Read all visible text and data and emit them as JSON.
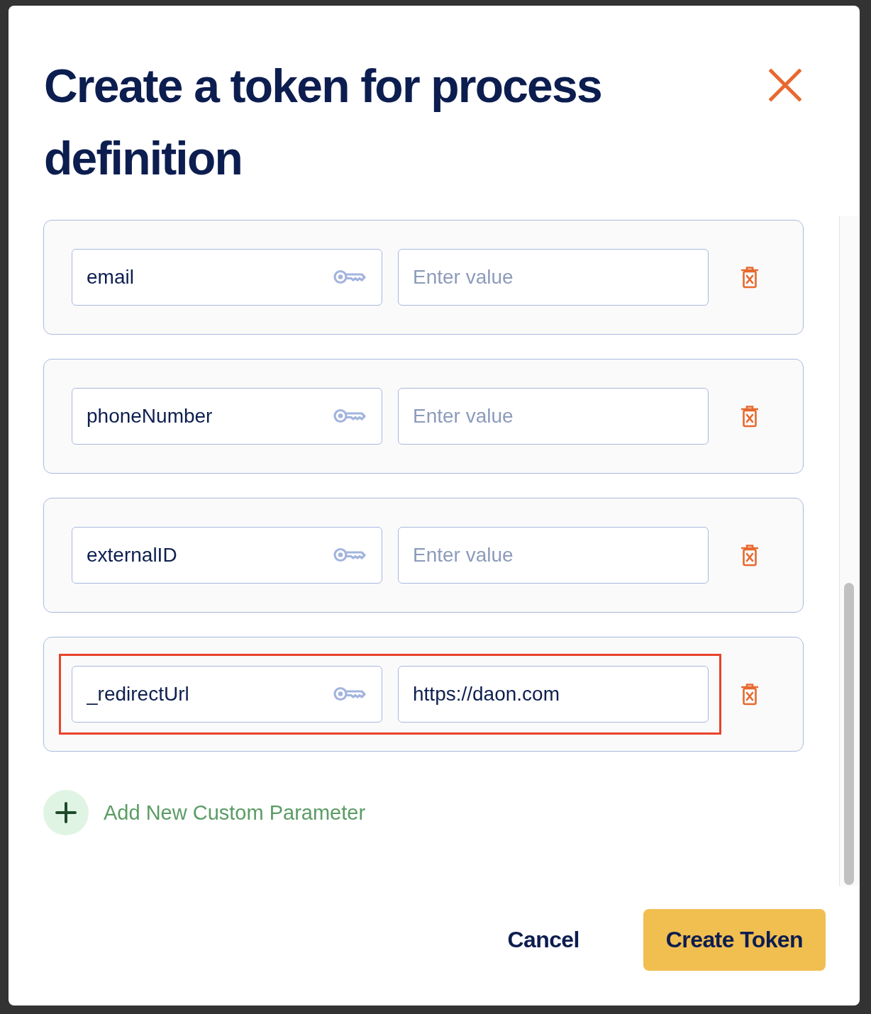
{
  "dialog": {
    "title": "Create a token for process definition"
  },
  "parameters": [
    {
      "key": "email",
      "placeholder": "Enter value",
      "highlighted": false
    },
    {
      "key": "phoneNumber",
      "placeholder": "Enter value",
      "highlighted": false
    },
    {
      "key": "externalID",
      "placeholder": "Enter value",
      "highlighted": false
    },
    {
      "key": "_redirectUrl",
      "value": "https://daon.com",
      "highlighted": true
    }
  ],
  "add_button": {
    "label": "Add New Custom Parameter"
  },
  "buttons": [
    {
      "label": "Cancel",
      "kind": "text"
    },
    {
      "label": "Create Token",
      "kind": "primary"
    }
  ]
}
